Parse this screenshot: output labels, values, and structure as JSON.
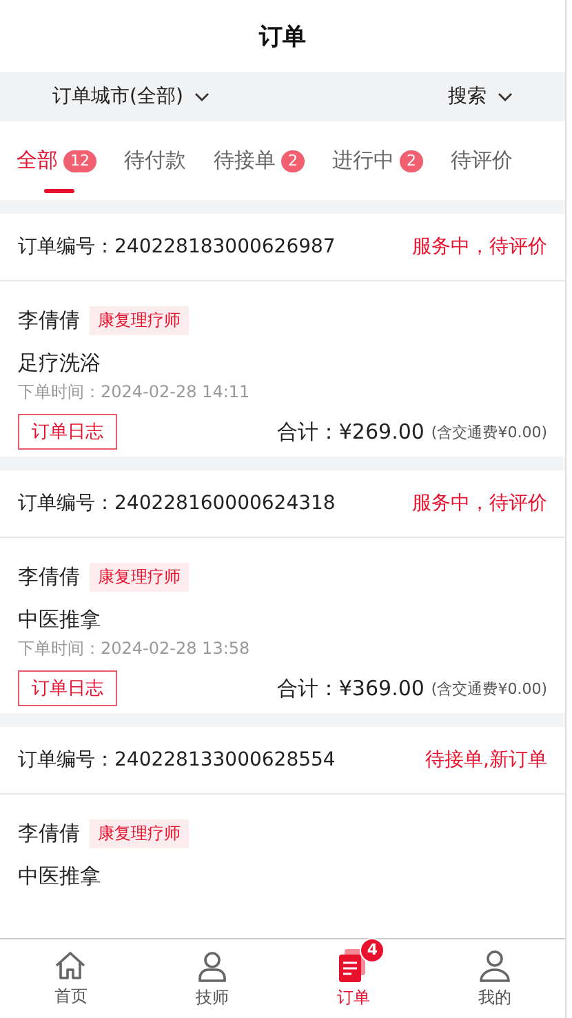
{
  "header": {
    "title": "订单"
  },
  "filters": [
    {
      "label": "订单城市(全部)"
    },
    {
      "label": "搜索"
    }
  ],
  "tabs": [
    {
      "label": "全部",
      "count": "12",
      "selected": true
    },
    {
      "label": "待付款",
      "selected": false
    },
    {
      "label": "待接单",
      "count": "2",
      "selected": false
    },
    {
      "label": "进行中",
      "count": "2",
      "selected": false
    },
    {
      "label": "待评价",
      "selected": false
    }
  ],
  "orders": [
    {
      "number_label": "订单编号：",
      "number": "240228183000626987",
      "status": "服务中，待评价",
      "technician": "李倩倩",
      "tag": "康复理疗师",
      "service": "足疗洗浴",
      "time": "下单时间：2024-02-28 14:11",
      "log_button": "订单日志",
      "total": "合计：¥269.00",
      "fee": "(含交通费¥0.00)"
    },
    {
      "number_label": "订单编号：",
      "number": "240228160000624318",
      "status": "服务中，待评价",
      "technician": "李倩倩",
      "tag": "康复理疗师",
      "service": "中医推拿",
      "time": "下单时间：2024-02-28 13:58",
      "log_button": "订单日志",
      "total": "合计：¥369.00",
      "fee": "(含交通费¥0.00)"
    },
    {
      "number_label": "订单编号：",
      "number": "240228133000628554",
      "status": "待接单,新订单",
      "technician": "李倩倩",
      "tag": "康复理疗师",
      "service": "中医推拿"
    }
  ],
  "bottom_nav": [
    {
      "label": "首页",
      "kind": "home",
      "selected": false
    },
    {
      "label": "技师",
      "kind": "technician",
      "selected": false
    },
    {
      "label": "订单",
      "kind": "orders",
      "selected": true,
      "badge": "4"
    },
    {
      "label": "我的",
      "kind": "profile",
      "selected": false
    }
  ]
}
